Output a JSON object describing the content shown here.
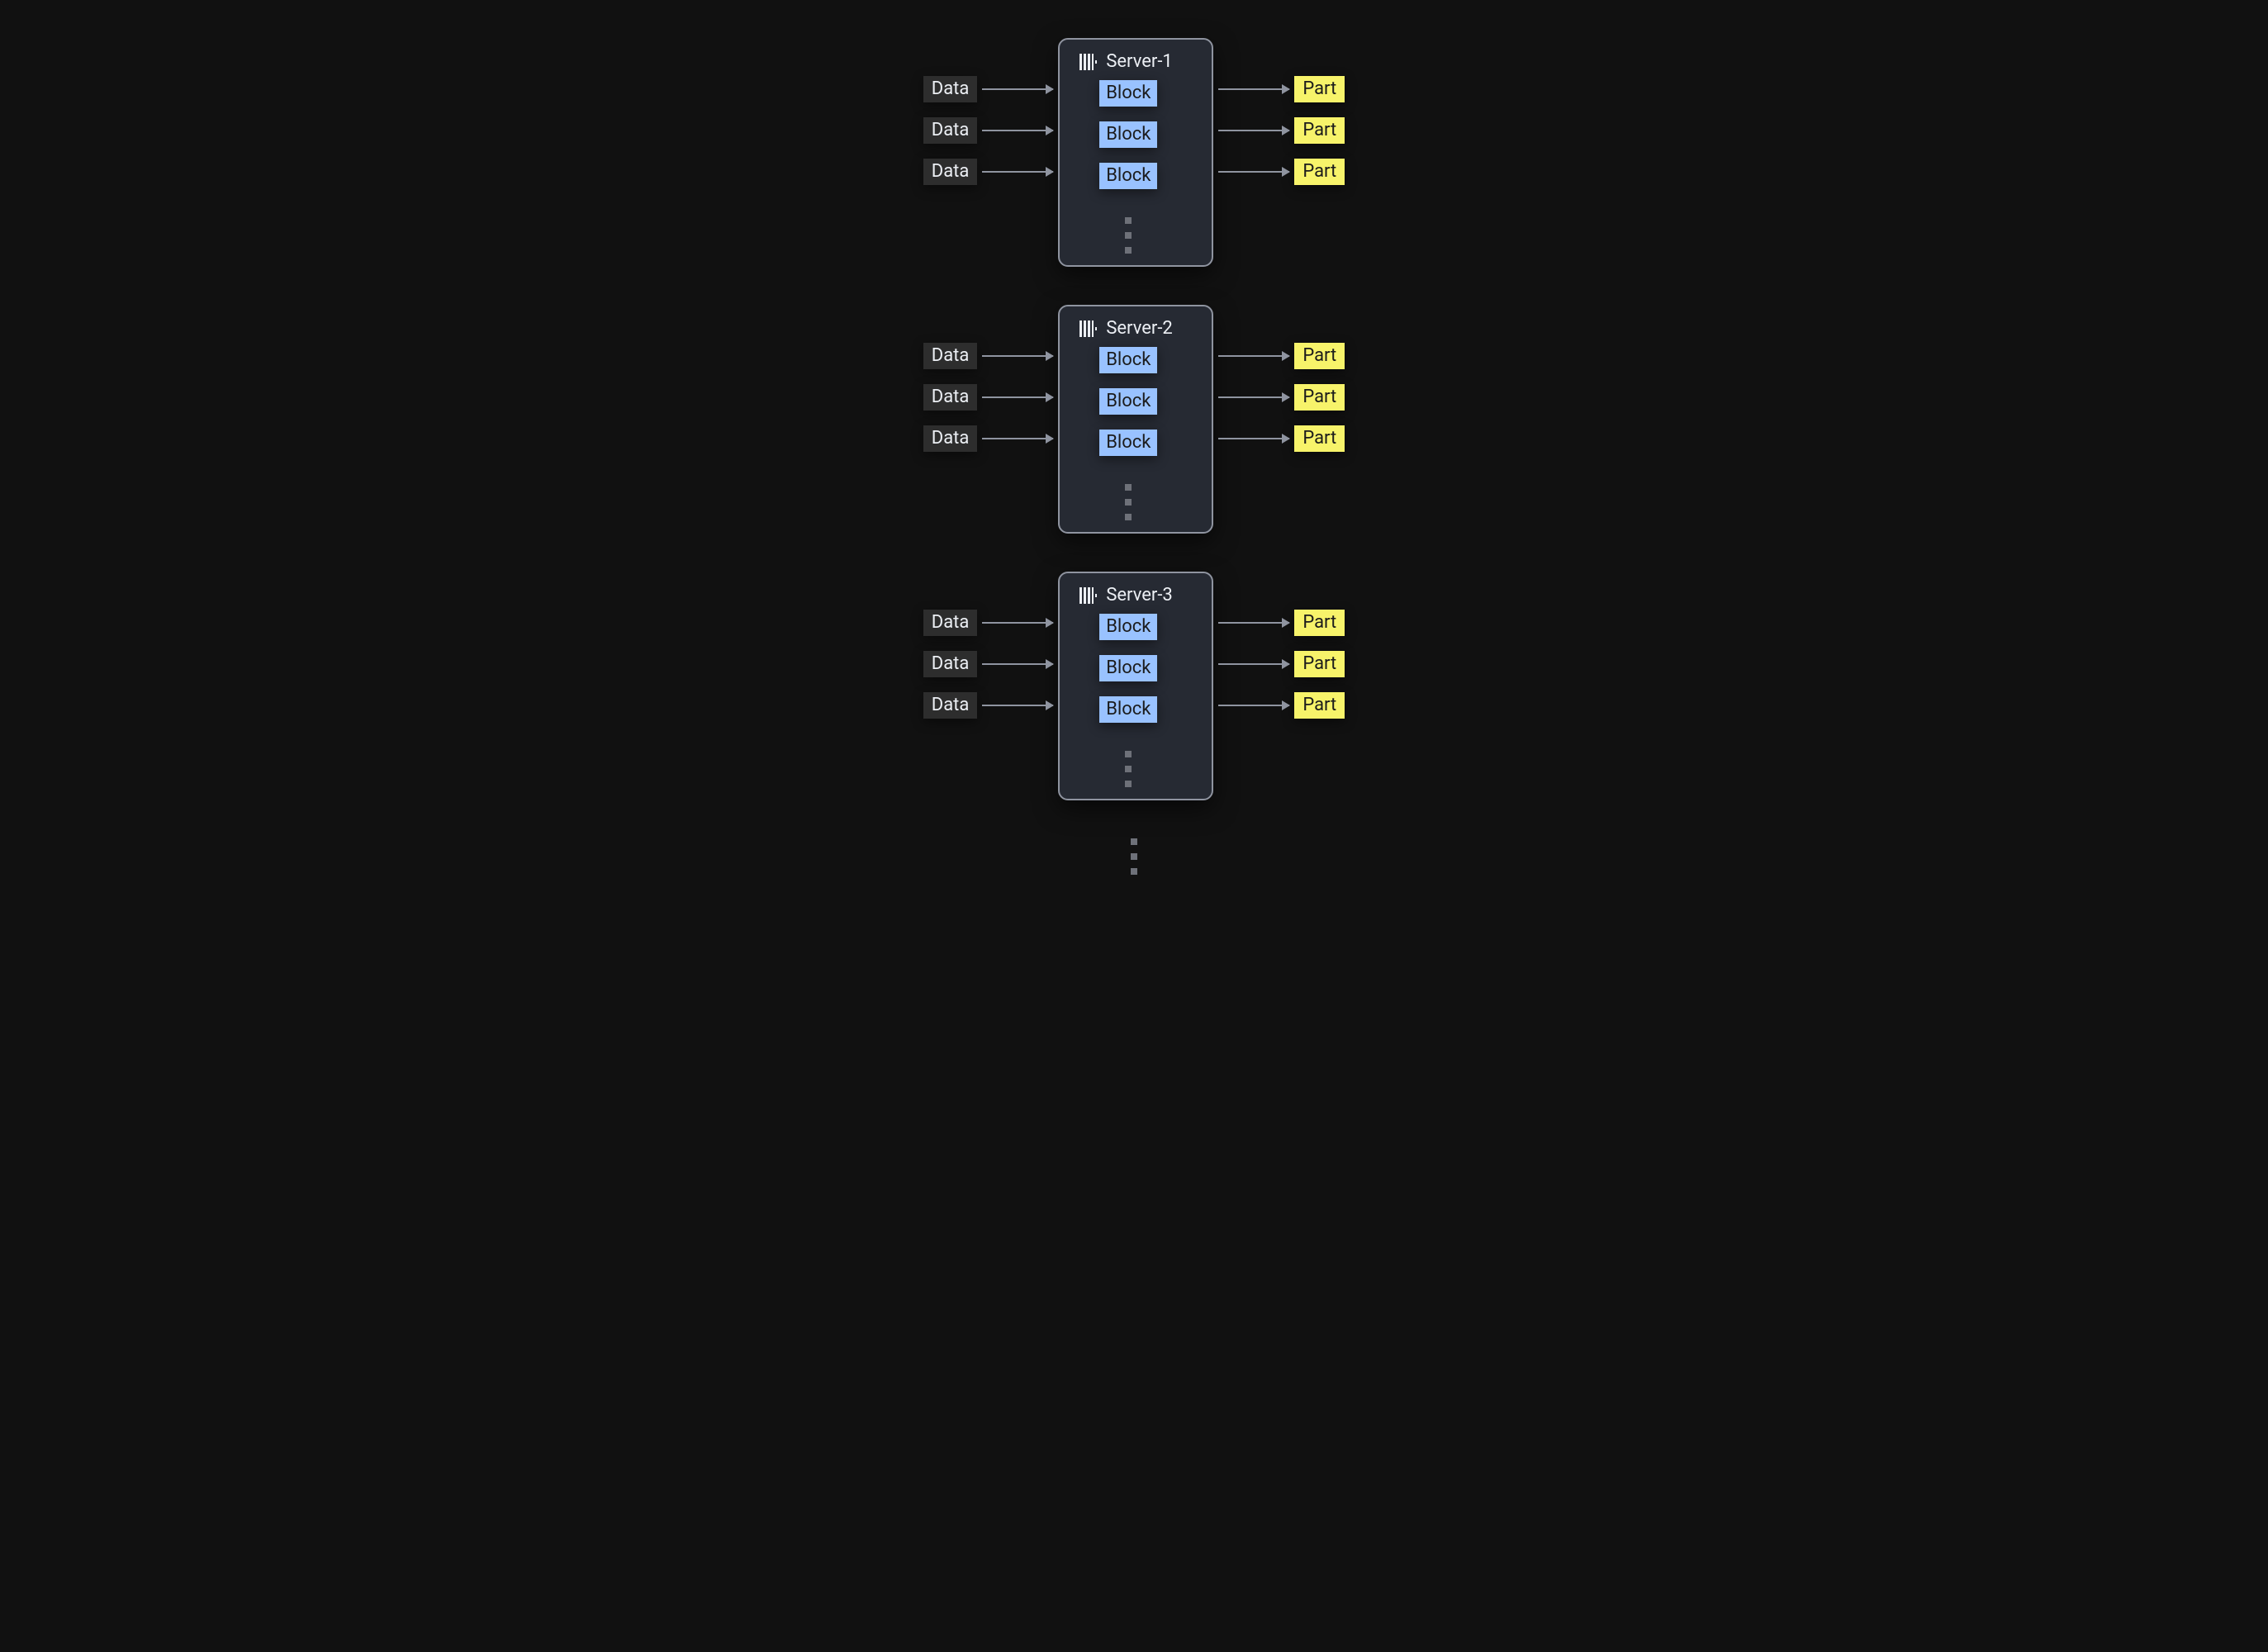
{
  "servers": [
    {
      "title": "Server-1",
      "rows": [
        {
          "data": "Data",
          "block": "Block",
          "part": "Part"
        },
        {
          "data": "Data",
          "block": "Block",
          "part": "Part"
        },
        {
          "data": "Data",
          "block": "Block",
          "part": "Part"
        }
      ]
    },
    {
      "title": "Server-2",
      "rows": [
        {
          "data": "Data",
          "block": "Block",
          "part": "Part"
        },
        {
          "data": "Data",
          "block": "Block",
          "part": "Part"
        },
        {
          "data": "Data",
          "block": "Block",
          "part": "Part"
        }
      ]
    },
    {
      "title": "Server-3",
      "rows": [
        {
          "data": "Data",
          "block": "Block",
          "part": "Part"
        },
        {
          "data": "Data",
          "block": "Block",
          "part": "Part"
        },
        {
          "data": "Data",
          "block": "Block",
          "part": "Part"
        }
      ]
    }
  ]
}
